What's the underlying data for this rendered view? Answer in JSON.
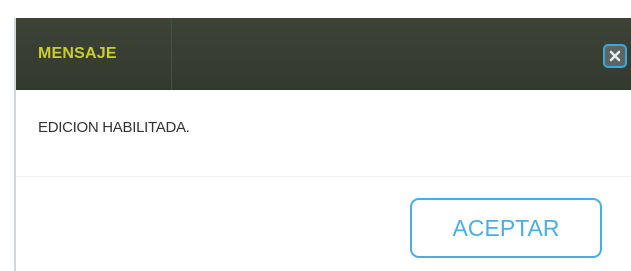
{
  "dialog": {
    "title": "MENSAJE",
    "message": "EDICION HABILITADA.",
    "close_icon": "close-icon",
    "accept_label": "ACEPTAR"
  },
  "colors": {
    "titlebar_bg": "#3d4436",
    "title_text": "#c8cf2a",
    "accent": "#49aee8"
  }
}
